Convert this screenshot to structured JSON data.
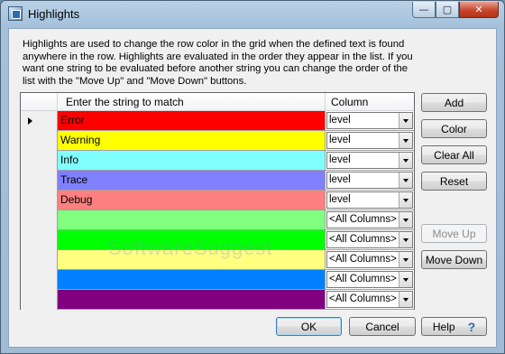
{
  "window": {
    "title": "Highlights",
    "controls": {
      "minimize": "—",
      "maximize": "▢",
      "close": "✕"
    }
  },
  "description": "Highlights are used to change the row color in the grid when the defined text is found anywhere in the row. Highlights are evaluated in the order they appear in the list. If you want one string to be evaluated before another string you can change the order of the list with the \"Move Up\" and \"Move Down\" buttons.",
  "grid": {
    "headers": {
      "string": "Enter the string to match",
      "column": "Column"
    },
    "rows": [
      {
        "text": "Error",
        "color": "#ff0000",
        "column": "level",
        "current": true
      },
      {
        "text": "Warning",
        "color": "#ffff00",
        "column": "level",
        "current": false
      },
      {
        "text": "Info",
        "color": "#80ffff",
        "column": "level",
        "current": false
      },
      {
        "text": "Trace",
        "color": "#8080ff",
        "column": "level",
        "current": false
      },
      {
        "text": "Debug",
        "color": "#ff8080",
        "column": "level",
        "current": false
      },
      {
        "text": "",
        "color": "#80ff80",
        "column": "<All Columns>",
        "current": false
      },
      {
        "text": "",
        "color": "#00ff00",
        "column": "<All Columns>",
        "current": false
      },
      {
        "text": "",
        "color": "#ffff80",
        "column": "<All Columns>",
        "current": false
      },
      {
        "text": "",
        "color": "#0080ff",
        "column": "<All Columns>",
        "current": false
      },
      {
        "text": "",
        "color": "#800080",
        "column": "<All Columns>",
        "current": false
      }
    ]
  },
  "side_buttons": {
    "add": "Add",
    "color": "Color",
    "clear_all": "Clear All",
    "reset": "Reset",
    "move_up": "Move Up",
    "move_down": "Move Down"
  },
  "footer": {
    "ok": "OK",
    "cancel": "Cancel",
    "help": "Help",
    "help_icon": "?"
  },
  "watermark": "SoftwareSuggest"
}
